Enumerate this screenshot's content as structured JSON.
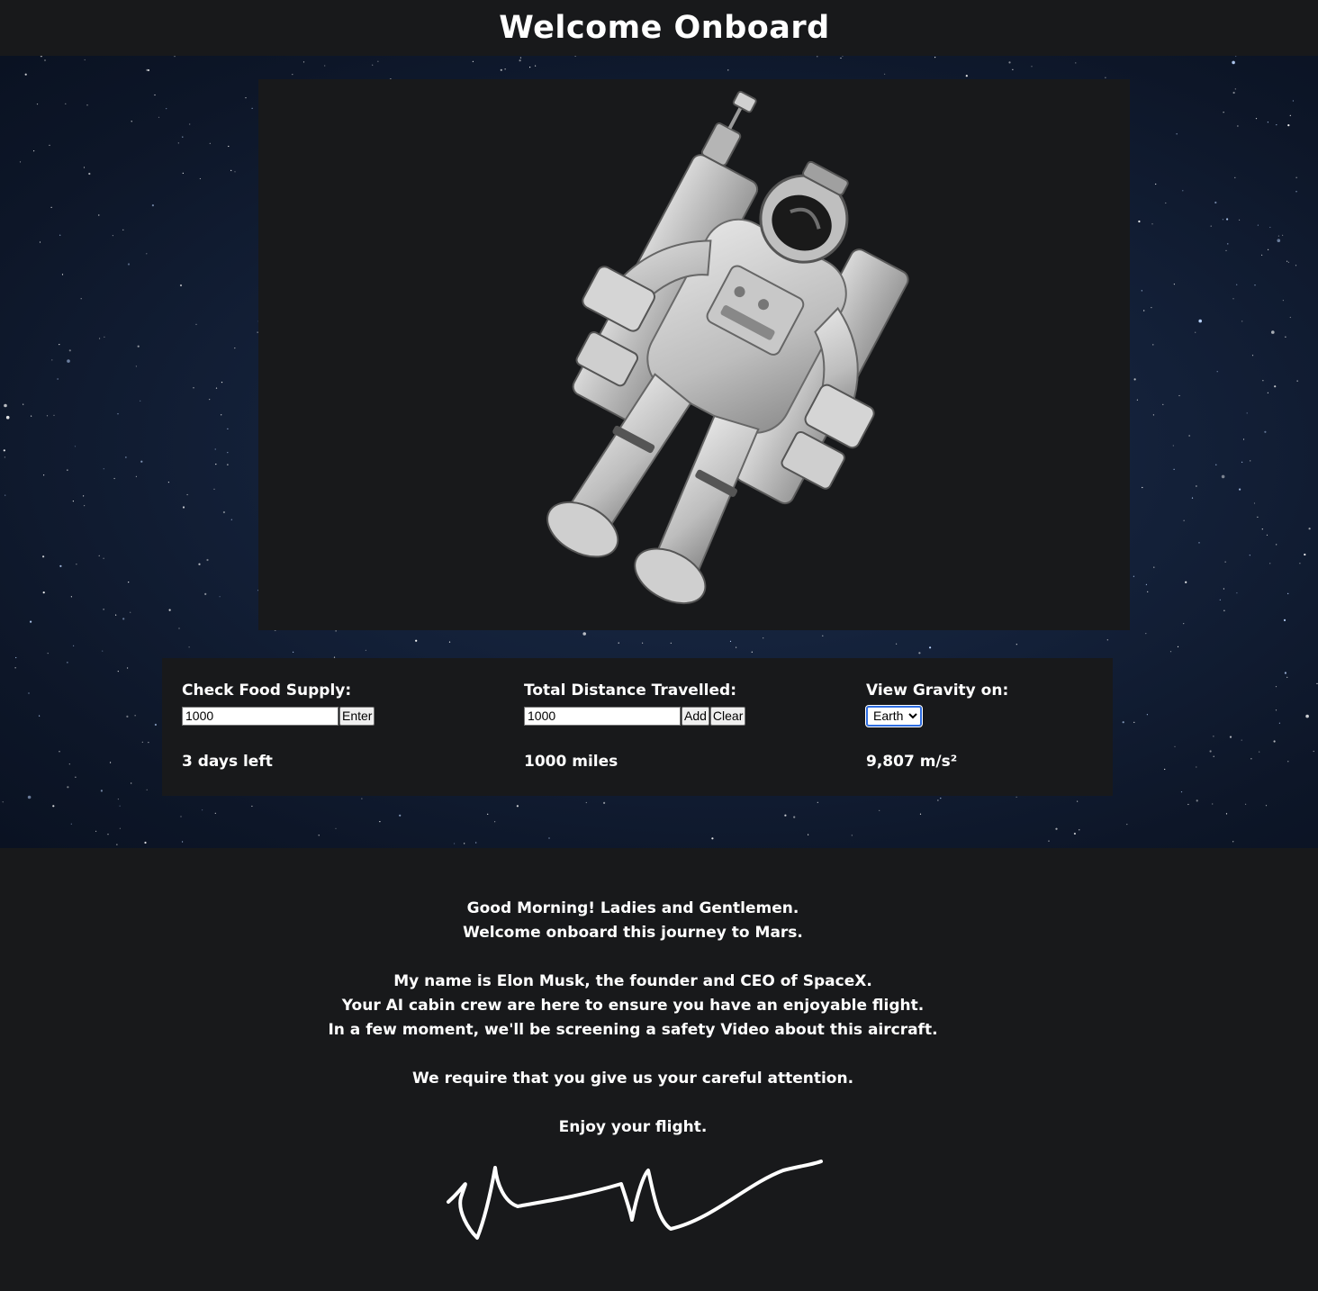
{
  "header": {
    "title": "Welcome Onboard"
  },
  "hero": {
    "image": "astronaut-photo"
  },
  "controls": {
    "food": {
      "label": "Check Food Supply:",
      "input_value": "1000",
      "button_label": "Enter",
      "result": "3 days left"
    },
    "distance": {
      "label": "Total Distance Travelled:",
      "input_value": "1000",
      "add_label": "Add",
      "clear_label": "Clear",
      "result": "1000 miles"
    },
    "gravity": {
      "label": "View Gravity on:",
      "selected": "Earth",
      "result": "9,807 m/s²"
    }
  },
  "message": {
    "line1": "Good Morning! Ladies and Gentlemen.",
    "line2": "Welcome onboard this journey to Mars.",
    "line3": "My name is Elon Musk, the founder and CEO of SpaceX.",
    "line4": "Your AI cabin crew are here to ensure you have an enjoyable flight.",
    "line5": "In a few moment, we'll be screening a safety Video about this aircraft.",
    "line6": "We require that you give us your careful attention.",
    "line7": "Enjoy your flight."
  },
  "signature": {
    "text": "Elon Musk"
  },
  "colors": {
    "page_bg": "#18191b",
    "space_bg": "#132038",
    "text": "#ffffff",
    "select_focus": "#2f6ee2"
  }
}
